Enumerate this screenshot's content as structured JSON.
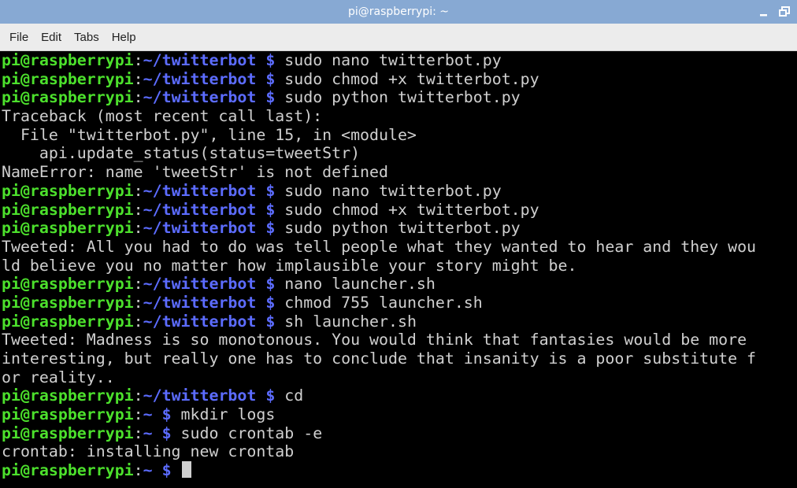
{
  "window": {
    "title": "pi@raspberrypi: ~"
  },
  "menu": [
    "File",
    "Edit",
    "Tabs",
    "Help"
  ],
  "colors": {
    "prompt_user": "#4ce02c",
    "prompt_path": "#5c6cff",
    "text": "#d0d0d0",
    "titlebar": "#87a9d3"
  },
  "lines": [
    {
      "type": "prompt",
      "user": "pi@raspberrypi",
      "path": "~/twitterbot",
      "cmd": " sudo nano twitterbot.py"
    },
    {
      "type": "prompt",
      "user": "pi@raspberrypi",
      "path": "~/twitterbot",
      "cmd": " sudo chmod +x twitterbot.py"
    },
    {
      "type": "prompt",
      "user": "pi@raspberrypi",
      "path": "~/twitterbot",
      "cmd": " sudo python twitterbot.py"
    },
    {
      "type": "output",
      "text": "Traceback (most recent call last):"
    },
    {
      "type": "output",
      "text": "  File \"twitterbot.py\", line 15, in <module>"
    },
    {
      "type": "output",
      "text": "    api.update_status(status=tweetStr)"
    },
    {
      "type": "output",
      "text": "NameError: name 'tweetStr' is not defined"
    },
    {
      "type": "prompt",
      "user": "pi@raspberrypi",
      "path": "~/twitterbot",
      "cmd": " sudo nano twitterbot.py"
    },
    {
      "type": "prompt",
      "user": "pi@raspberrypi",
      "path": "~/twitterbot",
      "cmd": " sudo chmod +x twitterbot.py"
    },
    {
      "type": "prompt",
      "user": "pi@raspberrypi",
      "path": "~/twitterbot",
      "cmd": " sudo python twitterbot.py"
    },
    {
      "type": "output",
      "text": "Tweeted: All you had to do was tell people what they wanted to hear and they wou"
    },
    {
      "type": "output",
      "text": "ld believe you no matter how implausible your story might be."
    },
    {
      "type": "prompt",
      "user": "pi@raspberrypi",
      "path": "~/twitterbot",
      "cmd": " nano launcher.sh"
    },
    {
      "type": "prompt",
      "user": "pi@raspberrypi",
      "path": "~/twitterbot",
      "cmd": " chmod 755 launcher.sh"
    },
    {
      "type": "prompt",
      "user": "pi@raspberrypi",
      "path": "~/twitterbot",
      "cmd": " sh launcher.sh"
    },
    {
      "type": "output",
      "text": "Tweeted: Madness is so monotonous. You would think that fantasies would be more"
    },
    {
      "type": "output",
      "text": "interesting, but really one has to conclude that insanity is a poor substitute f"
    },
    {
      "type": "output",
      "text": "or reality.."
    },
    {
      "type": "prompt",
      "user": "pi@raspberrypi",
      "path": "~/twitterbot",
      "cmd": " cd"
    },
    {
      "type": "prompt",
      "user": "pi@raspberrypi",
      "path": "~",
      "cmd": " mkdir logs"
    },
    {
      "type": "prompt",
      "user": "pi@raspberrypi",
      "path": "~",
      "cmd": " sudo crontab -e"
    },
    {
      "type": "output",
      "text": "crontab: installing new crontab"
    },
    {
      "type": "prompt",
      "user": "pi@raspberrypi",
      "path": "~",
      "cmd": " ",
      "cursor": true
    }
  ]
}
